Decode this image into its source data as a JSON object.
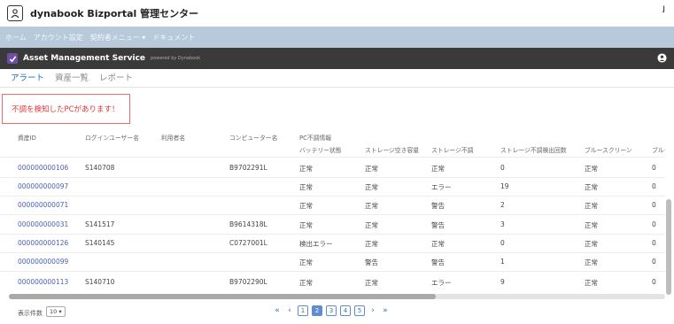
{
  "header": {
    "title": "dynabook Bizportal 管理センター",
    "corner_mark": "ȷ"
  },
  "menu": [
    {
      "label": "ホーム"
    },
    {
      "label": "アカウント設定"
    },
    {
      "label": "契約者メニュー ▾"
    },
    {
      "label": "ドキュメント"
    }
  ],
  "app": {
    "name": "Asset Management Service",
    "powered_by": "powered by Dynabook"
  },
  "tabs": [
    {
      "label": "アラート"
    },
    {
      "label": "資産一覧"
    },
    {
      "label": "レポート"
    }
  ],
  "alert": {
    "message": "不調を検知したPCがあります！"
  },
  "table": {
    "headers": {
      "asset_id": "資産ID",
      "login_user": "ログインユーザー名",
      "user_name": "利用者名",
      "computer_name": "コンピューター名",
      "pc_info": "PC不調情報"
    },
    "subheaders": {
      "battery": "バッテリー状態",
      "storage_free": "ストレージ空き容量",
      "storage_fault": "ストレージ不調",
      "storage_fault_count": "ストレージ不調検出回数",
      "bluescreen": "ブルースクリーン",
      "bluescreen_count": "ブルース"
    },
    "rows": [
      {
        "id": "000000000106",
        "login": "S140708",
        "user": "",
        "computer": "B9702291L",
        "battery": "正常",
        "free": "正常",
        "fault": "正常",
        "count": "0",
        "bsod": "正常",
        "bsod_count": "0"
      },
      {
        "id": "000000000097",
        "login": "",
        "user": "",
        "computer": "",
        "battery": "正常",
        "free": "正常",
        "fault": "エラー",
        "count": "19",
        "bsod": "正常",
        "bsod_count": "0"
      },
      {
        "id": "000000000071",
        "login": "",
        "user": "",
        "computer": "",
        "battery": "正常",
        "free": "正常",
        "fault": "警告",
        "count": "2",
        "bsod": "正常",
        "bsod_count": "0"
      },
      {
        "id": "000000000031",
        "login": "S141517",
        "user": "",
        "computer": "B9614318L",
        "battery": "正常",
        "free": "正常",
        "fault": "警告",
        "count": "3",
        "bsod": "正常",
        "bsod_count": "0"
      },
      {
        "id": "000000000126",
        "login": "S140145",
        "user": "",
        "computer": "C0727001L",
        "battery": "検出エラー",
        "free": "正常",
        "fault": "正常",
        "count": "0",
        "bsod": "正常",
        "bsod_count": "0"
      },
      {
        "id": "000000000099",
        "login": "",
        "user": "",
        "computer": "",
        "battery": "正常",
        "free": "警告",
        "fault": "警告",
        "count": "1",
        "bsod": "正常",
        "bsod_count": "0"
      },
      {
        "id": "000000000113",
        "login": "S140710",
        "user": "",
        "computer": "B9702290L",
        "battery": "正常",
        "free": "正常",
        "fault": "エラー",
        "count": "9",
        "bsod": "正常",
        "bsod_count": "0"
      }
    ]
  },
  "footer": {
    "page_size_label": "表示件数",
    "page_size_value": "10 ▾",
    "pager": {
      "first": "«",
      "prev": "‹",
      "pages": [
        "1",
        "2",
        "3",
        "4",
        "5"
      ],
      "current": "2",
      "next": "›",
      "last": "»"
    }
  },
  "colors": {
    "menubar": "#b7c9db",
    "appbar": "#3a3a3a",
    "accent": "#1d6fb8",
    "alert": "#e03838",
    "link": "#4a5fb5"
  }
}
